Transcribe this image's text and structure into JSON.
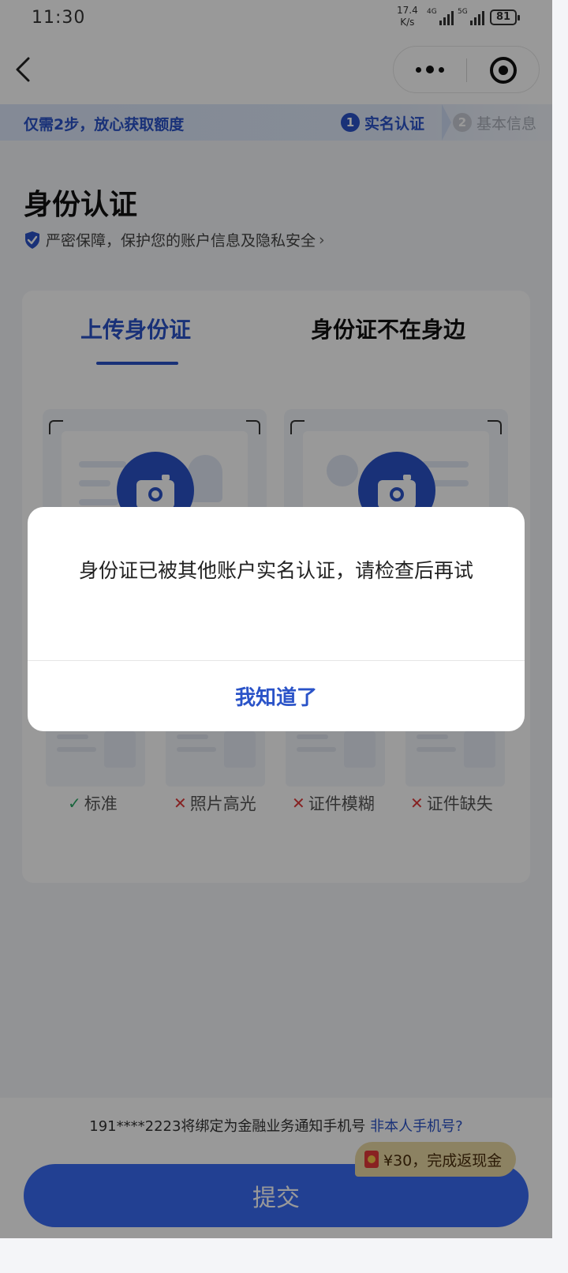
{
  "status_bar": {
    "time": "11:30",
    "net_speed_value": "17.4",
    "net_speed_unit": "K/s",
    "signal1_label": "4G",
    "signal2_label": "5G",
    "battery": "81"
  },
  "nav": {
    "back_icon": "chevron-left-icon",
    "more_icon": "more-dots-icon",
    "close_icon": "target-circle-icon"
  },
  "steps": {
    "promo": "仅需2步，放心获取额度",
    "items": [
      {
        "num": "1",
        "label": "实名认证",
        "active": true
      },
      {
        "num": "2",
        "label": "基本信息",
        "active": false
      }
    ]
  },
  "page": {
    "title": "身份认证",
    "security_text": "严密保障，保护您的账户信息及隐私安全",
    "security_chevron": "›"
  },
  "tabs": [
    {
      "label": "上传身份证",
      "active": true
    },
    {
      "label": "身份证不在身边",
      "active": false
    }
  ],
  "samples": [
    {
      "label": "标准",
      "status": "ok",
      "mark": "✓"
    },
    {
      "label": "照片高光",
      "status": "bad",
      "mark": "✕"
    },
    {
      "label": "证件模糊",
      "status": "bad",
      "mark": "✕"
    },
    {
      "label": "证件缺失",
      "status": "bad",
      "mark": "✕"
    }
  ],
  "bottom": {
    "phone_notice": "191****2223将绑定为金融业务通知手机号",
    "phone_link": "非本人手机号?",
    "cashback": "¥30，完成返现金",
    "submit": "提交"
  },
  "dialog": {
    "message": "身份证已被其他账户实名认证，请检查后再试",
    "confirm": "我知道了"
  },
  "colors": {
    "primary": "#2a53c8",
    "button": "#3a6bf3",
    "ok": "#2aa866",
    "bad": "#e0393a",
    "cashback_bg": "#ead9a4"
  }
}
